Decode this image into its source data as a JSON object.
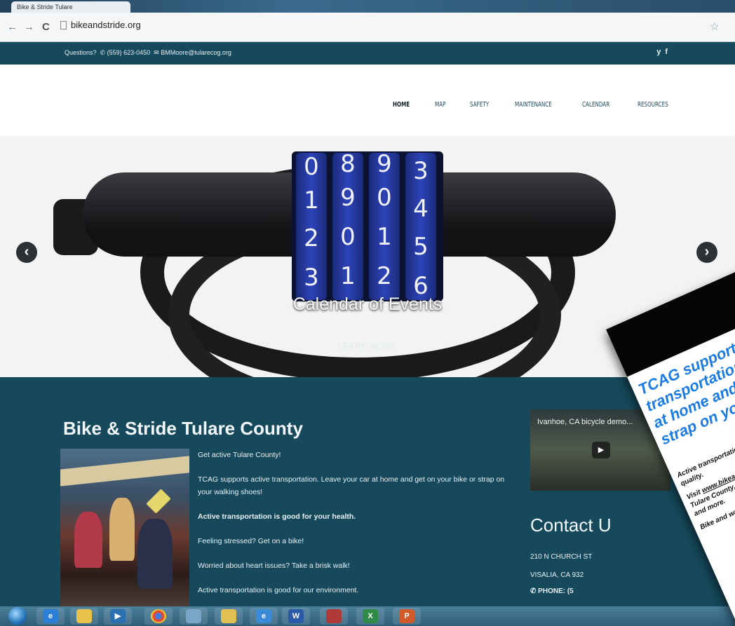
{
  "browser": {
    "tab_title": "Bike & Stride Tulare",
    "url": "bikeandstride.org",
    "nav": {
      "back": "←",
      "forward": "→",
      "reload": "C"
    },
    "star": "☆"
  },
  "topbar": {
    "questions": "Questions?",
    "phone": "(559) 623-0450",
    "email": "BMMoore@tularecog.org",
    "social": [
      "y",
      "f"
    ]
  },
  "menu": {
    "items": [
      "HOME",
      "MAP",
      "SAFETY",
      "MAINTENANCE",
      "CALENDAR",
      "RESOURCES"
    ],
    "active_index": 0
  },
  "hero": {
    "title": "Calendar of Events",
    "button": "LEARN MORE",
    "dials": [
      [
        "0",
        "1",
        "2",
        "3"
      ],
      [
        "8",
        "9",
        "0",
        "1"
      ],
      [
        "9",
        "0",
        "1",
        "2"
      ],
      [
        "3",
        "4",
        "5",
        "6"
      ]
    ],
    "prev": "‹",
    "next": "›"
  },
  "main": {
    "title": "Bike & Stride Tulare County",
    "paragraphs": [
      {
        "text": "Get active Tulare County!",
        "bold": false
      },
      {
        "text": "TCAG supports active transportation. Leave your car at home and get on your bike or strap on your walking shoes!",
        "bold": false
      },
      {
        "text": "Active transportation is good for your health.",
        "bold": true
      },
      {
        "text": "Feeling stressed? Get on a bike!",
        "bold": false
      },
      {
        "text": "Worried about heart issues? Take a brisk walk!",
        "bold": false
      },
      {
        "text": "Active transportation is good for our environment.",
        "bold": false
      }
    ],
    "video_title": "Ivanhoe, CA bicycle demo...",
    "contact_title": "Contact U",
    "address_line1": "210 N CHURCH ST",
    "address_line2": "VISALIA, CA 932",
    "phone_label": "PHONE: (5"
  },
  "flyer": {
    "headline": "TCAG supports active transportation. Leave your car at home and get on your bike or strap on your walking shoes!",
    "body1": "Active transportation is good for your health and good for our air quality.",
    "body2_prefix": "Visit ",
    "body2_link": "www.bikeandstride.org",
    "body2_suffix": " for a map of bike trails and paths through Tulare County, biking and walking safety tips, maintenance reminders and more.",
    "body3": "Bike and walk for a cleaner Tulare County and good health!"
  },
  "taskbar": {
    "apps": [
      "ie-icon",
      "folder-icon",
      "media-icon",
      "chrome-icon",
      "paint-icon",
      "explorer-icon",
      "ie2-icon",
      "word-icon",
      "access-icon",
      "excel-icon",
      "powerpoint-icon"
    ],
    "labels": {
      "word": "W",
      "excel": "X",
      "powerpoint": "P"
    }
  }
}
